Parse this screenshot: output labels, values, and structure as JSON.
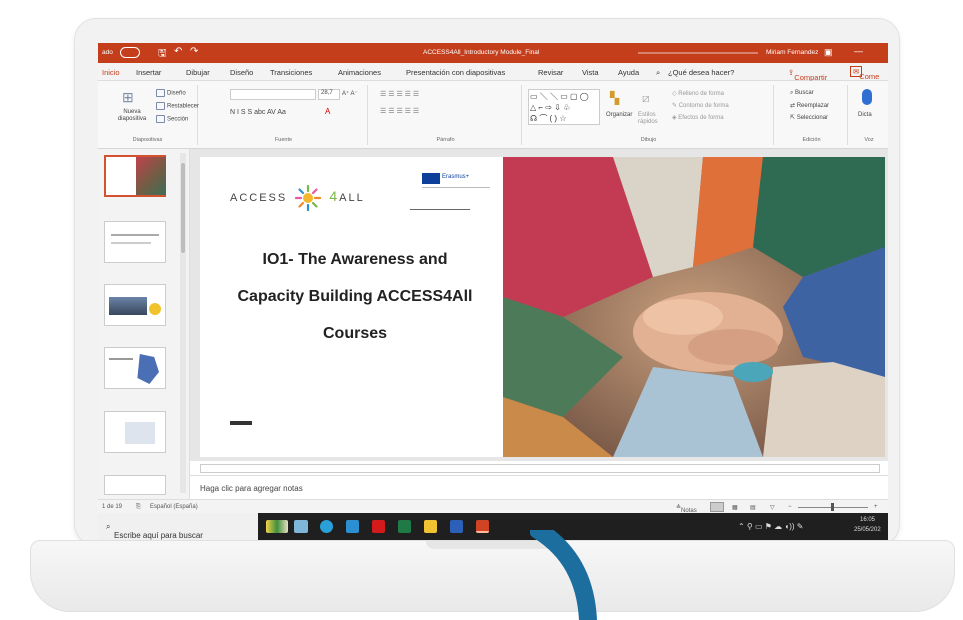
{
  "window": {
    "autosave": "ado",
    "title": "ACCESS4All_Introductory Module_Final",
    "user": "Miriam Fernandez"
  },
  "menu": {
    "items": [
      "Inicio",
      "Insertar",
      "Dibujar",
      "Diseño",
      "Transiciones",
      "Animaciones",
      "Presentación con diapositivas",
      "Revisar",
      "Vista",
      "Ayuda"
    ],
    "help_search": "¿Qué desea hacer?",
    "share": "Compartir",
    "comments": "Come"
  },
  "ribbon": {
    "new_slide": "Nueva diapositiva",
    "layout": "Diseño",
    "reset": "Restablecer",
    "section": "Sección",
    "group_slides": "Diapositivas",
    "font_size": "28,7",
    "bold_row": "N  I  S  S  abc  AV  Aa",
    "group_font": "Fuente",
    "group_paragraph": "Párrafo",
    "arrange": "Organizar",
    "quick_styles": "Estilos rápidos",
    "shape_fill": "Relleno de forma",
    "shape_outline": "Contorno de forma",
    "shape_effects": "Efectos de forma",
    "group_drawing": "Dibujo",
    "find": "Buscar",
    "replace": "Reemplazar",
    "select": "Seleccionar",
    "group_editing": "Edición",
    "dictate": "Dicta",
    "group_voice": "Voz"
  },
  "slide": {
    "logo_left": "ACCESS",
    "logo_four": "4",
    "logo_right": "ALL",
    "erasmus": "Erasmus+",
    "title": "IO1- The Awareness and\nCapacity Building ACCESS4All\nCourses"
  },
  "notes_placeholder": "Haga clic para agregar notas",
  "status": {
    "slide_count": "1 de 19",
    "language": "Español (España)",
    "notes": "Notas"
  },
  "taskbar": {
    "search": "Escribe aquí para buscar",
    "time": "16:05",
    "date": "25/05/202"
  },
  "colors": {
    "accent": "#c43e1c",
    "taskbar": "#1f1f1f",
    "cable": "#1c6e9e"
  }
}
